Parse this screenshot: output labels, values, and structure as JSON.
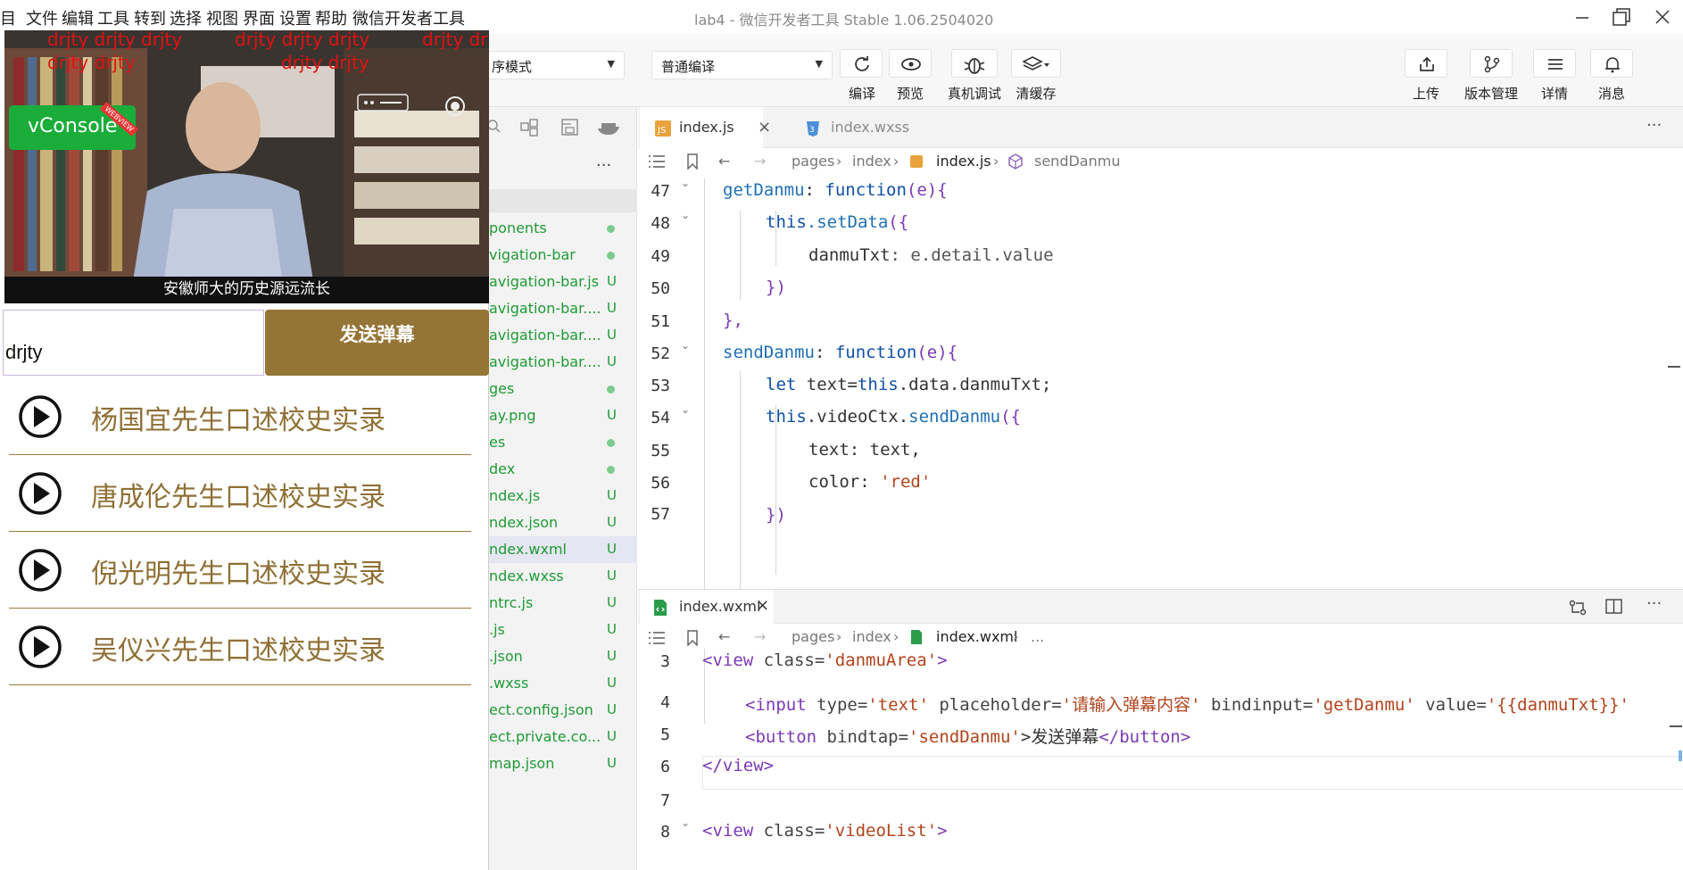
{
  "menu": [
    "目",
    "文件",
    "编辑",
    "工具",
    "转到",
    "选择",
    "视图",
    "界面",
    "设置",
    "帮助",
    "微信开发者工具"
  ],
  "window_title": "lab4 - 微信开发者工具 Stable 1.06.2504020",
  "toolbar": {
    "mode_select": "序模式",
    "compile_select": "普通编译",
    "buttons": [
      {
        "label": "编译",
        "icon": "refresh-icon"
      },
      {
        "label": "预览",
        "icon": "eye-icon"
      },
      {
        "label": "真机调试",
        "icon": "bug-icon"
      },
      {
        "label": "清缓存",
        "icon": "layers-icon"
      }
    ],
    "right_buttons": [
      {
        "label": "上传",
        "icon": "upload-icon"
      },
      {
        "label": "版本管理",
        "icon": "branch-icon"
      },
      {
        "label": "详情",
        "icon": "menu-icon"
      },
      {
        "label": "消息",
        "icon": "bell-icon"
      }
    ]
  },
  "simulator": {
    "danmu": [
      "drjty drjty drjty",
      "drjty drjty drjty",
      "drjty dr",
      "drjty drjty",
      "drjty drjty"
    ],
    "vconsole_label": "vConsole",
    "vconsole_ribbon": "WEBVIEW",
    "subtitle": "安徽师大的历史源远流长",
    "input_value": "drjty",
    "send_button": "发送弹幕",
    "videos": [
      "杨国宜先生口述校史实录",
      "唐成伦先生口述校史实录",
      "倪光明先生口述校史实录",
      "吴仪兴先生口述校史实录"
    ]
  },
  "explorer": {
    "more": "...",
    "files": [
      {
        "name": "ponents",
        "status": "dot"
      },
      {
        "name": "vigation-bar",
        "status": "dot"
      },
      {
        "name": "avigation-bar.js",
        "status": "U"
      },
      {
        "name": "avigation-bar....",
        "status": "U"
      },
      {
        "name": "avigation-bar....",
        "status": "U"
      },
      {
        "name": "avigation-bar....",
        "status": "U"
      },
      {
        "name": "ges",
        "status": "dot"
      },
      {
        "name": "ay.png",
        "status": "U"
      },
      {
        "name": "es",
        "status": "dot"
      },
      {
        "name": "dex",
        "status": "dot"
      },
      {
        "name": "ndex.js",
        "status": "U"
      },
      {
        "name": "ndex.json",
        "status": "U"
      },
      {
        "name": "ndex.wxml",
        "status": "U"
      },
      {
        "name": "ndex.wxss",
        "status": "U"
      },
      {
        "name": "ntrc.js",
        "status": "U"
      },
      {
        "name": ".js",
        "status": "U"
      },
      {
        "name": ".json",
        "status": "U"
      },
      {
        "name": ".wxss",
        "status": "U"
      },
      {
        "name": "ect.config.json",
        "status": "U"
      },
      {
        "name": "ect.private.co...",
        "status": "U"
      },
      {
        "name": "map.json",
        "status": "U"
      }
    ]
  },
  "editor_top": {
    "tabs": [
      "index.js",
      "index.wxss"
    ],
    "more": "···",
    "breadcrumb": [
      "pages",
      "index",
      "index.js",
      "sendDanmu"
    ],
    "line_numbers": [
      "47",
      "48",
      "49",
      "50",
      "51",
      "52",
      "53",
      "54",
      "55",
      "56",
      "57"
    ],
    "code": {
      "l47_name": "getDanmu",
      "l47_rest": ": ",
      "l47_kw": "function",
      "l47_par": "(e){",
      "l48_this": "this",
      "l48_fn": ".setData",
      "l48_par": "({",
      "l49_key": "danmuTxt",
      "l49_val": ": e.detail.value",
      "l50": "})",
      "l51": "},",
      "l52_name": "sendDanmu",
      "l52_rest": ": ",
      "l52_kw": "function",
      "l52_par": "(e){",
      "l53_let": "let",
      "l53_rest": " text=",
      "l53_this": "this",
      "l53_tail": ".data.danmuTxt;",
      "l54_this": "this",
      "l54_mid": ".videoCtx.",
      "l54_fn": "sendDanmu",
      "l54_par": "({",
      "l55": "text: text,",
      "l56_key": "color: ",
      "l56_val": "'red'",
      "l57": "})"
    }
  },
  "editor_bottom": {
    "tab": "index.wxml",
    "close": "×",
    "more": "···",
    "breadcrumb": [
      "pages",
      "index",
      "index.wxml",
      "..."
    ],
    "line_numbers": [
      "3",
      "4",
      "5",
      "6",
      "7",
      "8"
    ],
    "code": {
      "l3_tag": "<view",
      "l3_attr": " class=",
      "l3_val": "'danmuArea'",
      "l3_end": ">",
      "l4_tag": "<input",
      "l4_a1": " type=",
      "l4_v1": "'text'",
      "l4_a2": " placeholder=",
      "l4_v2": "'请输入弹幕内容'",
      "l4_a3": " bindinput=",
      "l4_v3": "'getDanmu'",
      "l4_a4": " value=",
      "l4_v4": "'{{danmuTxt}}'",
      "l5_tag": "<button",
      "l5_a1": " bindtap=",
      "l5_v1": "'sendDanmu'",
      "l5_text": ">发送弹幕",
      "l5_close": "</button>",
      "l6": "</view>",
      "l8_tag": "<view",
      "l8_attr": " class=",
      "l8_val": "'videoList'",
      "l8_end": ">"
    }
  }
}
